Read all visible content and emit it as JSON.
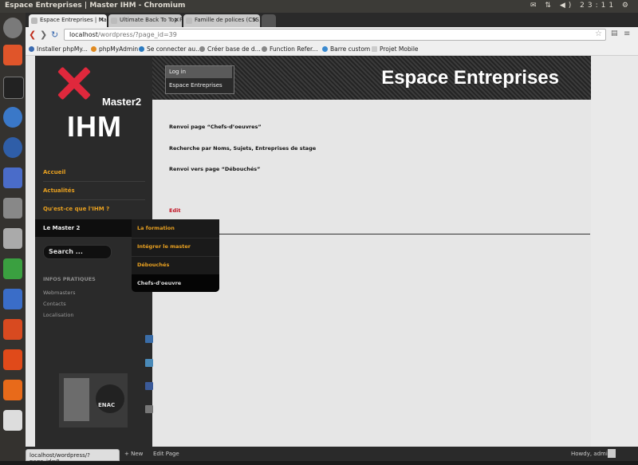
{
  "os": {
    "window_title": "Espace Entreprises | Master IHM - Chromium",
    "clock": "23:11"
  },
  "tabs": [
    {
      "label": "Espace Entreprises | Mas"
    },
    {
      "label": "Ultimate Back To Top Pag"
    },
    {
      "label": "Famille de polices (CSS) - V"
    }
  ],
  "address": {
    "host": "localhost",
    "path": "/wordpress/?page_id=39"
  },
  "bookmarks": [
    "Installer phpMy...",
    "phpMyAdmin",
    "Se connecter au...",
    "Créer base de d...",
    "Function Refer...",
    "Barre custom",
    "Projet Mobile"
  ],
  "site": {
    "title": "Espace Entreprises",
    "logo_master": "Master2",
    "logo_ihm": "IHM",
    "login": "Log in",
    "login_sub": "Espace Entreprises",
    "nav": {
      "accueil": "Accueil",
      "actualites": "Actualités",
      "quest_ce": "Qu'est-ce que l'IHM ?",
      "master2": "Le Master 2"
    },
    "dropdown": [
      "La formation",
      "Intégrer le master",
      "Débouchés",
      "Chefs-d'oeuvre"
    ],
    "search_placeholder": "Search ...",
    "infos_heading": "INFOS PRATIQUES",
    "infos_links": [
      "Webmasters",
      "Contacts",
      "Localisation"
    ],
    "enac": "ENAC"
  },
  "content": {
    "paragraphs": [
      "Renvoi page “Chefs-d’oeuvres”",
      "Recherche par Noms, Sujets, Entreprises de stage",
      "Renvoi vers page “Débouchés”"
    ],
    "edit": "Edit"
  },
  "adminbar": {
    "new": "New",
    "edit_page": "Edit Page",
    "howdy": "Howdy, admin"
  },
  "statusbar": "localhost/wordpress/?page_id=8"
}
